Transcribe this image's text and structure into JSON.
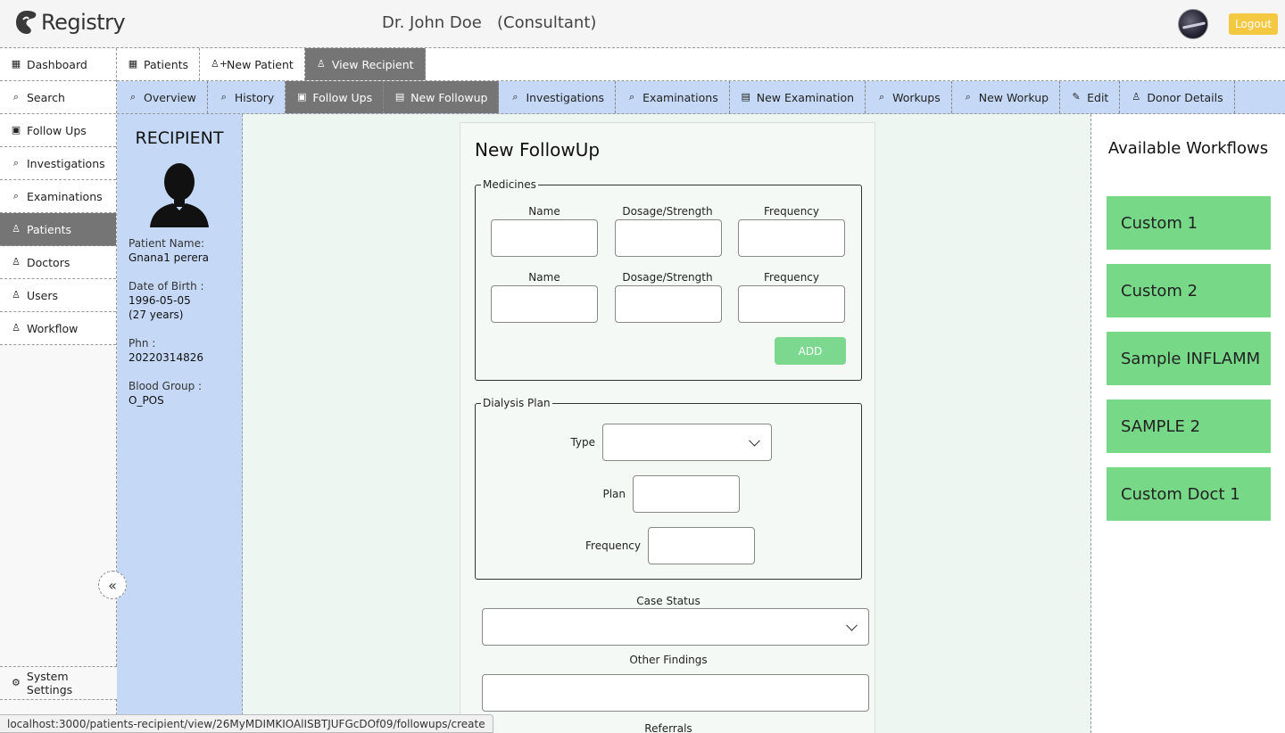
{
  "app": {
    "name": "Registry"
  },
  "header": {
    "user_title": "Dr. John Doe   (Consultant)",
    "logout_label": "Logout"
  },
  "sidebar": {
    "items": [
      {
        "label": "Dashboard",
        "icon": "dashboard-icon"
      },
      {
        "label": "Search",
        "icon": "search-icon"
      },
      {
        "label": "Follow Ups",
        "icon": "calendar-icon"
      },
      {
        "label": "Investigations",
        "icon": "search-icon"
      },
      {
        "label": "Examinations",
        "icon": "search-icon"
      },
      {
        "label": "Patients",
        "icon": "user-icon",
        "active": true
      },
      {
        "label": "Doctors",
        "icon": "user-icon"
      },
      {
        "label": "Users",
        "icon": "user-icon"
      },
      {
        "label": "Workflow",
        "icon": "user-icon"
      }
    ],
    "bottom": [
      {
        "label": "System Settings",
        "icon": "gear-icon"
      }
    ]
  },
  "tabs_top": [
    {
      "label": "Patients",
      "icon": "dashboard-icon"
    },
    {
      "label": "New Patient",
      "icon": "add-user-icon"
    },
    {
      "label": "View Recipient",
      "icon": "user-icon",
      "active": true
    }
  ],
  "tabs_sub": [
    {
      "label": "Overview",
      "icon": "search-icon"
    },
    {
      "label": "History",
      "icon": "search-icon"
    },
    {
      "label": "Follow Ups",
      "icon": "calendar-icon",
      "active": true
    },
    {
      "label": "New Followup",
      "icon": "document-icon",
      "active": true
    },
    {
      "label": "Investigations",
      "icon": "search-icon"
    },
    {
      "label": "Examinations",
      "icon": "search-icon"
    },
    {
      "label": "New Examination",
      "icon": "document-icon"
    },
    {
      "label": "Workups",
      "icon": "search-icon"
    },
    {
      "label": "New Workup",
      "icon": "search-icon"
    },
    {
      "label": "Edit",
      "icon": "pencil-icon"
    },
    {
      "label": "Donor Details",
      "icon": "user-icon"
    }
  ],
  "recipient": {
    "title": "RECIPIENT",
    "name_label": "Patient Name:",
    "name": "Gnana1 perera",
    "dob_label": "Date of Birth :",
    "dob": "1996-05-05",
    "age": "(27 years)",
    "phn_label": "Phn :",
    "phn": "20220314826",
    "blood_label": "Blood Group :",
    "blood": "O_POS"
  },
  "form": {
    "title": "New FollowUp",
    "medicines": {
      "legend": "Medicines",
      "col_name": "Name",
      "col_dosage": "Dosage/Strength",
      "col_frequency": "Frequency",
      "add_label": "ADD"
    },
    "dialysis": {
      "legend": "Dialysis Plan",
      "type_label": "Type",
      "plan_label": "Plan",
      "frequency_label": "Frequency"
    },
    "case_status_label": "Case Status",
    "other_findings_label": "Other Findings",
    "referrals_label": "Referrals"
  },
  "workflows": {
    "title": "Available Workflows",
    "items": [
      "Custom 1",
      "Custom 2",
      "Sample INFLAMM",
      "SAMPLE 2",
      "Custom Doct 1"
    ],
    "color": "#77d888"
  },
  "status_url": "localhost:3000/patients-recipient/view/26MyMDIMKIOAlISBTJUFGcDOf09/followups/create",
  "colors": {
    "accent_blue": "#c5d9f7",
    "active_tab": "#757575",
    "logout": "#f5c842",
    "add_button": "#7dd88f"
  }
}
